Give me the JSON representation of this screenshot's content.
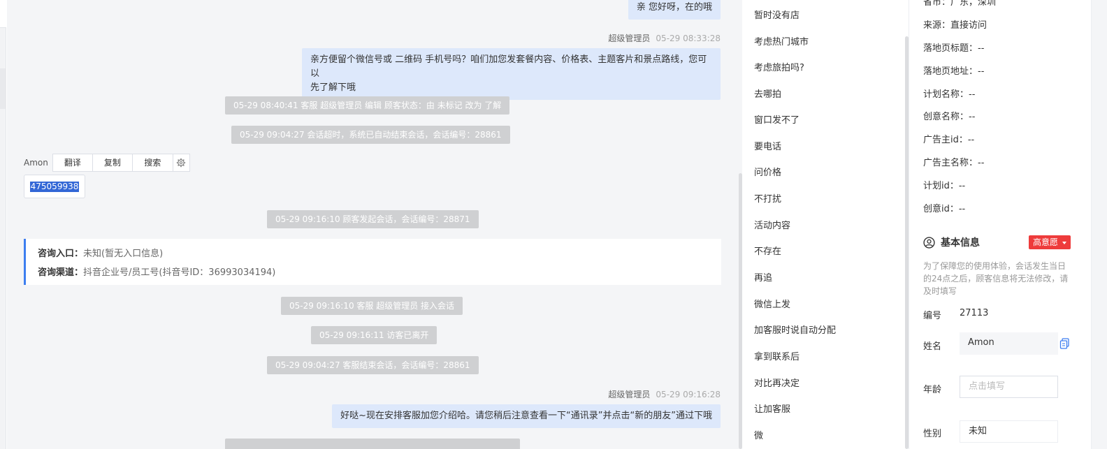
{
  "chat": {
    "msg1": "亲 您好呀，在的哦",
    "sender2": {
      "name": "超级管理员",
      "time": "05-29 08:33:28"
    },
    "msg2_line1": "亲方便留个微信号或 二维码 手机号吗？咱们加您发套餐内容、价格表、主题客片和景点路线，您可以",
    "msg2_line2": "先了解下哦",
    "sys1": "05-29 08:40:41 客服 超级管理员 编辑 顾客状态：由 未标记 改为 了解",
    "sys2": "05-29 09:04:27 会话超时，系统已自动结束会话，会话编号：28861",
    "customer_name": "Amon",
    "tools": [
      "翻译",
      "复制",
      "搜索"
    ],
    "customer_msg": "475059938",
    "sys3": "05-29 09:16:10 顾客发起会话，会话编号：28871",
    "consult": {
      "entry_label": "咨询入口：",
      "entry_value": "未知(暂无入口信息)",
      "channel_label": "咨询渠道：",
      "channel_value": "抖音企业号/员工号(抖音号ID：36993034194)"
    },
    "sys4": "05-29 09:16:10 客服 超级管理员 接入会话",
    "sys5": "05-29 09:16:11 访客已离开",
    "sys6": "05-29 09:04:27 客服结束会话，会话编号：28861",
    "sender3": {
      "name": "超级管理员",
      "time": "05-29 09:16:28"
    },
    "msg3": "好哒~现在安排客服加您介绍哈。请您稍后注意查看一下“通讯录”并点击“新的朋友”通过下哦"
  },
  "quick_replies": [
    "暂时没有店",
    "考虑热门城市",
    "考虑旅拍吗?",
    "去哪拍",
    "窗口发不了",
    "要电话",
    "问价格",
    "不打扰",
    "活动内容",
    "不存在",
    "再追",
    "微信上发",
    "加客服时说自动分配",
    "拿到联系后",
    "对比再决定",
    "让加客服",
    "微"
  ],
  "info": {
    "location_partial": "省市：广东，深圳",
    "source": "来源：直接访问",
    "landing_title": "落地页标题：--",
    "landing_url": "落地页地址：--",
    "plan_name": "计划名称：--",
    "creative_name": "创意名称：--",
    "advertiser_id": "广告主id：--",
    "advertiser_name": "广告主名称：--",
    "plan_id": "计划id：--",
    "creative_id": "创意id：--",
    "basic_title": "基本信息",
    "intent_badge": "高意愿",
    "notice": "为了保障您的使用体验，会话发生当日的24点之后，顾客信息将无法修改，请及时填写",
    "id_label": "编号",
    "id_value": "27113",
    "name_label": "姓名",
    "name_value": "Amon",
    "age_label": "年龄",
    "age_placeholder": "点击填写",
    "gender_label": "性别",
    "gender_value": "未知"
  },
  "colors": {
    "accent": "#3d7ef0",
    "bubble": "#dde8fb",
    "badge": "#ee3b3b",
    "system": "#cfd0d2"
  }
}
